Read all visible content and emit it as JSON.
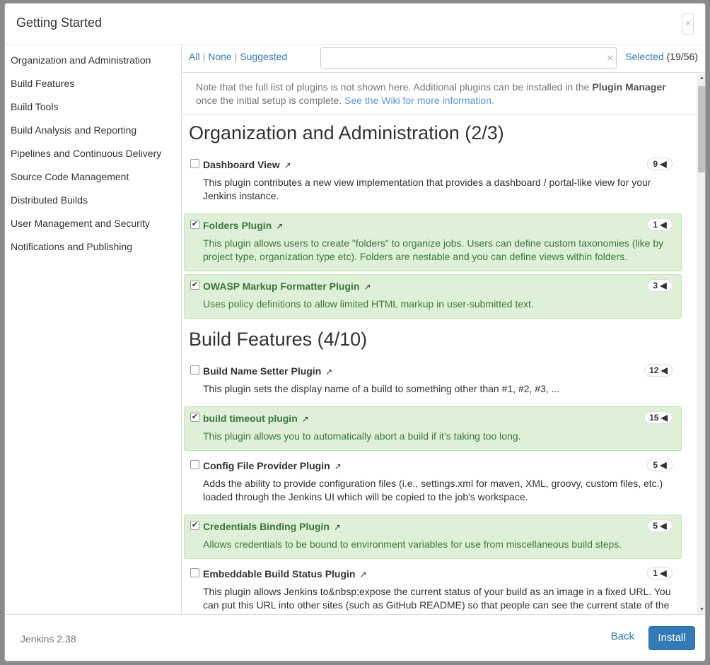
{
  "header": {
    "title": "Getting Started",
    "close_label": "×"
  },
  "sidebar": {
    "items": [
      {
        "label": "Organization and Administration"
      },
      {
        "label": "Build Features"
      },
      {
        "label": "Build Tools"
      },
      {
        "label": "Build Analysis and Reporting"
      },
      {
        "label": "Pipelines and Continuous Delivery"
      },
      {
        "label": "Source Code Management"
      },
      {
        "label": "Distributed Builds"
      },
      {
        "label": "User Management and Security"
      },
      {
        "label": "Notifications and Publishing"
      }
    ]
  },
  "toolbar": {
    "all": "All",
    "none": "None",
    "suggested": "Suggested",
    "sep": "|",
    "search_value": "",
    "clear": "×",
    "selected_label": "Selected",
    "selected_count": "(19/56)"
  },
  "note": {
    "text_before": "Note that the full list of plugins is not shown here. Additional plugins can be installed in the ",
    "bold": "Plugin Manager",
    "text_after": " once the initial setup is complete. ",
    "link": "See the Wiki for more information."
  },
  "categories": [
    {
      "title": "Organization and Administration (2/3)",
      "plugins": [
        {
          "name": "Dashboard View",
          "checked": false,
          "deps": "9",
          "desc": "This plugin contributes a new view implementation that provides a dashboard / portal-like view for your Jenkins instance."
        },
        {
          "name": "Folders Plugin",
          "checked": true,
          "deps": "1",
          "desc": "This plugin allows users to create \"folders\" to organize jobs. Users can define custom taxonomies (like by project type, organization type etc). Folders are nestable and you can define views within folders."
        },
        {
          "name": "OWASP Markup Formatter Plugin",
          "checked": true,
          "deps": "3",
          "desc": "Uses policy definitions to allow limited HTML markup in user-submitted text."
        }
      ]
    },
    {
      "title": "Build Features (4/10)",
      "plugins": [
        {
          "name": "Build Name Setter Plugin",
          "checked": false,
          "deps": "12",
          "desc": "This plugin sets the display name of a build to something other than #1, #2, #3, ..."
        },
        {
          "name": "build timeout plugin",
          "checked": true,
          "deps": "15",
          "desc": "This plugin allows you to automatically abort a build if it’s taking too long."
        },
        {
          "name": "Config File Provider Plugin",
          "checked": false,
          "deps": "5",
          "desc": "Adds the ability to provide configuration files (i.e., settings.xml for maven, XML, groovy, custom files, etc.) loaded through the Jenkins UI which will be copied to the job's workspace."
        },
        {
          "name": "Credentials Binding Plugin",
          "checked": true,
          "deps": "5",
          "desc": "Allows credentials to be bound to environment variables for use from miscellaneous build steps."
        },
        {
          "name": "Embeddable Build Status Plugin",
          "checked": false,
          "deps": "1",
          "desc": "This plugin allows Jenkins to&nbsp;expose the current status of your build as an image in a fixed URL. You can put this URL into other sites (such as GitHub README) so that people can see the current state of the job (last build) or for a specific build."
        }
      ]
    }
  ],
  "icons": {
    "external": "external-link-icon",
    "caret": "caret-left-icon",
    "check": "checkmark-icon"
  },
  "footer": {
    "version": "Jenkins 2.38",
    "back": "Back",
    "install": "Install"
  },
  "colors": {
    "accent": "#337ab7",
    "selected_bg": "#dff0d8",
    "selected_text": "#3c763d"
  }
}
